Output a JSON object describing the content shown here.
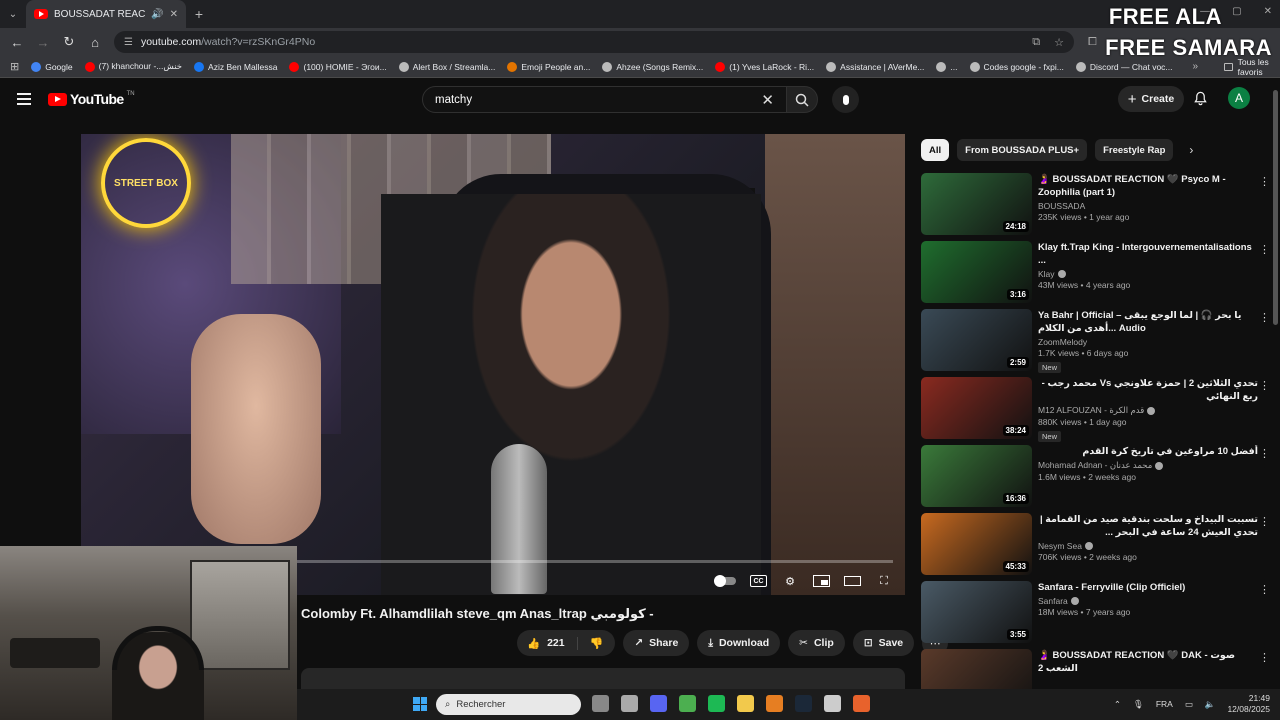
{
  "browser": {
    "tab_title": "BOUSSADAT REACTION",
    "url_domain": "youtube.com",
    "url_path": "/watch?v=rzSKnGr4PNo",
    "bookmarks": [
      {
        "label": "Google",
        "color": "#4285f4"
      },
      {
        "label": "(7) khanchour -...خنش",
        "color": "#ff0000"
      },
      {
        "label": "Aziz Ben Mallessa",
        "color": "#1877f2"
      },
      {
        "label": "(100) HOMIE - Эгои...",
        "color": "#ff0000"
      },
      {
        "label": "Alert Box / Streamla...",
        "color": "#bbbbbb"
      },
      {
        "label": "Emoji People an...",
        "color": "#e37400"
      },
      {
        "label": "Ahzee (Songs Remix...",
        "color": "#bbbbbb"
      },
      {
        "label": "(1) Yves LaRock - Ri...",
        "color": "#ff0000"
      },
      {
        "label": "Assistance | AVerMe...",
        "color": "#bbbbbb"
      },
      {
        "label": "...",
        "color": "#bbbbbb"
      },
      {
        "label": "Codes google - fxpi...",
        "color": "#bbbbbb"
      },
      {
        "label": "Discord — Chat voc...",
        "color": "#bbbbbb"
      }
    ],
    "all_bookmarks_label": "Tous les favoris"
  },
  "overlay": {
    "line1": "FREE ALA",
    "line2": "FREE SAMARA"
  },
  "youtube": {
    "logo_text": "YouTube",
    "logo_tm": "TN",
    "search_query": "matchy",
    "create_label": "Create",
    "avatar_letter": "A"
  },
  "player": {
    "neon_sign": "STREET BOX"
  },
  "video": {
    "title": "- كولومبي Colomby Ft. Alhamdlilah steve_qm Anas_ltrap",
    "like_count": "221",
    "share_label": "Share",
    "download_label": "Download",
    "clip_label": "Clip",
    "save_label": "Save"
  },
  "chips": [
    "All",
    "From BOUSSADA PLUS+",
    "Freestyle Rap"
  ],
  "recommendations": [
    {
      "title": "🤰 BOUSSADAT REACTION 🖤 Psyco M - Zoophilia (part 1)",
      "channel": "BOUSSADA",
      "verified": false,
      "meta": "235K views • 1 year ago",
      "duration": "24:18",
      "badge": "",
      "thumb_color": "#2e6b3a"
    },
    {
      "title": "Klay ft.Trap King - Intergouvernementalisations ...",
      "channel": "Klay",
      "verified": true,
      "meta": "43M views • 4 years ago",
      "duration": "3:16",
      "badge": "",
      "thumb_color": "#1f6e2e"
    },
    {
      "title": "Ya Bahr | Official – يا بحر 🎧 | لما الوجع يبقى أهدى من الكلام... Audio",
      "channel": "ZoomMelody",
      "verified": false,
      "meta": "1.7K views • 6 days ago",
      "duration": "2:59",
      "badge": "New",
      "thumb_color": "#3a4a56"
    },
    {
      "title": "تحدي الثلاثين 2 | حمزة علاونجي Vs محمد رجب - ربع النهائي",
      "channel": "M12 ALFOUZAN - قدم الكرة",
      "verified": true,
      "meta": "880K views • 1 day ago",
      "duration": "38:24",
      "badge": "New",
      "thumb_color": "#8a2a20"
    },
    {
      "title": "أفضل 10 مراوغين في تاريخ كرة القدم",
      "channel": "Mohamad Adnan - محمد عدنان",
      "verified": true,
      "meta": "1.6M views • 2 weeks ago",
      "duration": "16:36",
      "badge": "",
      "thumb_color": "#3a7a3a"
    },
    {
      "title": "تسببت البيداخ و سلحت بندقية صيد من القمامة | تحدي العيش 24 ساعة في البحر ...",
      "channel": "Nesym Sea",
      "verified": true,
      "meta": "706K views • 2 weeks ago",
      "duration": "45:33",
      "badge": "",
      "thumb_color": "#c86a20"
    },
    {
      "title": "Sanfara - Ferryville (Clip Officiel)",
      "channel": "Sanfara",
      "verified": true,
      "meta": "18M views • 7 years ago",
      "duration": "3:55",
      "badge": "",
      "thumb_color": "#4a5a66"
    },
    {
      "title": "🤰 BOUSSADAT REACTION 🖤 DAK - صوت الشعب 2",
      "channel": "",
      "verified": false,
      "meta": "",
      "duration": "",
      "badge": "",
      "thumb_color": "#5a3a2a"
    }
  ],
  "taskbar": {
    "search_placeholder": "Rechercher",
    "language": "FRA",
    "time": "21:49",
    "date": "12/08/2025",
    "icon_colors": [
      "#888888",
      "#aaaaaa",
      "#5865f2",
      "#4caf50",
      "#1db954",
      "#f2c94c",
      "#e67e22",
      "#1b2838",
      "#cccccc",
      "#e8622c"
    ]
  }
}
